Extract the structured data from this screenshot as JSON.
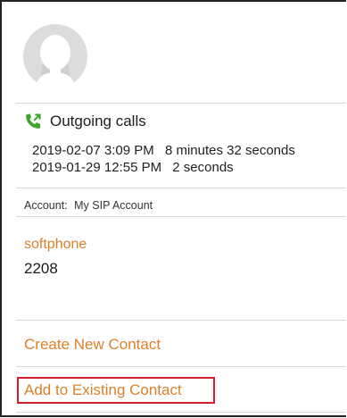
{
  "contact": {
    "avatar_icon": "avatar-silhouette-icon"
  },
  "calls": {
    "header_label": "Outgoing calls",
    "icon": "outgoing-call-icon",
    "accent_color": "#3da52b",
    "entries": [
      {
        "datetime": "2019-02-07 3:09 PM",
        "duration": "8 minutes 32 seconds"
      },
      {
        "datetime": "2019-01-29 12:55 PM",
        "duration": "2 seconds"
      }
    ]
  },
  "account": {
    "prefix": "Account:",
    "name": "My SIP Account"
  },
  "phone": {
    "label": "softphone",
    "number": "2208"
  },
  "actions": {
    "create_new": "Create New Contact",
    "add_existing": "Add to Existing Contact"
  },
  "colors": {
    "accent": "#d9822b",
    "highlight": "#d21f2d",
    "divider": "#d9d9d9"
  }
}
